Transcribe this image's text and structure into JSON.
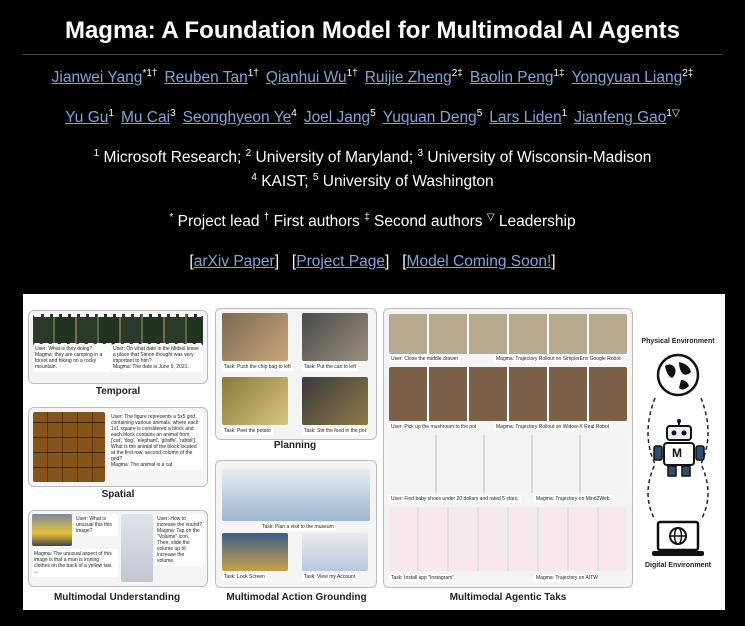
{
  "title": "Magma: A Foundation Model for Multimodal AI Agents",
  "authors_row1": [
    {
      "name": "Jianwei Yang",
      "sup": "*1†"
    },
    {
      "name": "Reuben Tan",
      "sup": "1†"
    },
    {
      "name": "Qianhui Wu",
      "sup": "1†"
    },
    {
      "name": "Ruijie Zheng",
      "sup": "2‡"
    },
    {
      "name": "Baolin Peng",
      "sup": "1‡"
    },
    {
      "name": "Yongyuan Liang",
      "sup": "2‡"
    }
  ],
  "authors_row2": [
    {
      "name": "Yu Gu",
      "sup": "1"
    },
    {
      "name": "Mu Cai",
      "sup": "3"
    },
    {
      "name": "Seonghyeon Ye",
      "sup": "4"
    },
    {
      "name": "Joel Jang",
      "sup": "5"
    },
    {
      "name": "Yuquan Deng",
      "sup": "5"
    },
    {
      "name": "Lars Liden",
      "sup": "1"
    },
    {
      "name": "Jianfeng Gao",
      "sup": "1▽"
    }
  ],
  "affiliations": {
    "line1": [
      {
        "sup": "1",
        "text": "Microsoft Research;"
      },
      {
        "sup": "2",
        "text": "University of Maryland;"
      },
      {
        "sup": "3",
        "text": "University of Wisconsin-Madison"
      }
    ],
    "line2": [
      {
        "sup": "4",
        "text": "KAIST;"
      },
      {
        "sup": "5",
        "text": "University of Washington"
      }
    ]
  },
  "roles": [
    {
      "sup": "*",
      "text": "Project lead"
    },
    {
      "sup": "†",
      "text": "First authors"
    },
    {
      "sup": "‡",
      "text": "Second authors"
    },
    {
      "sup": "▽",
      "text": "Leadership"
    }
  ],
  "links": [
    "arXiv Paper",
    "Project Page",
    "Model Coming Soon!"
  ],
  "figure": {
    "captions": {
      "temporal": "Temporal",
      "spatial": "Spatial",
      "planning": "Planning",
      "mm_understanding": "Multimodal Understanding",
      "mm_action": "Multimodal Action Grounding",
      "mm_agentic": "Multimodal Agentic Taks"
    },
    "environments": {
      "physical": "Physical Environment",
      "digital": "Digital Environment"
    },
    "robot_letter": "M",
    "chats": {
      "temporal_user": "User: What is they doing?",
      "temporal_magma": "Magma: they are camping in a forest and hiking on a rocky mountain.",
      "temporal_user2": "User: On what date in the Midsol leave a place that Simon thought was very important to him?",
      "temporal_magma2": "Magma: The date is June 9, 2021.",
      "spatial_user": "User: The figure represents a 5x5 grid containing various animals, where each 1x1 square is considered a block and each block contains an animal from ['cat', 'dog', 'elephant', 'giraffe', 'rabbit']. What is the animal of the block located at the first row, second column of the grid?",
      "spatial_magma": "Magma: The animal is a cat.",
      "mmu_user": "User: What is unusual this this image?",
      "mmu_magma": "Magma: The unusual aspect of this image is that a man is ironing clothes on the back of a yellow taxi. ...",
      "mmu_user2": "User: How to increase the sound?",
      "mmu_magma2": "Magma: Tap on the \"Volume\" icon. Then, slide the volume up to increase the volume.",
      "plan1": "Task: Push the chip bag to left",
      "plan2": "Task: Put the can to left",
      "plan3": "Task: Peel the potato",
      "plan4": "Task: Stir the food in the pot",
      "ground1": "Task: Plan a visit to the museum",
      "ground2": "Task: Lock Screen",
      "ground3": "Task: View my Account",
      "agent1_user": "User: Close the middle drawer",
      "agent1_magma": "Magma: Trajectory Rollout on SimplerEnv Google Robot",
      "agent2_user": "User: Pick up the mushroom to the pot",
      "agent2_magma": "Magma: Trajectory Rollout on Widow-X Real Robot",
      "agent3_user": "User: Find baby shoes under 20 dollars and rated 5 stars.",
      "agent3_magma": "Magma: Trajectory on Mind2Web",
      "agent4_user": "Task: Install app \"Instagram\"",
      "agent4_magma": "Magma: Trajectory on AITW"
    }
  }
}
